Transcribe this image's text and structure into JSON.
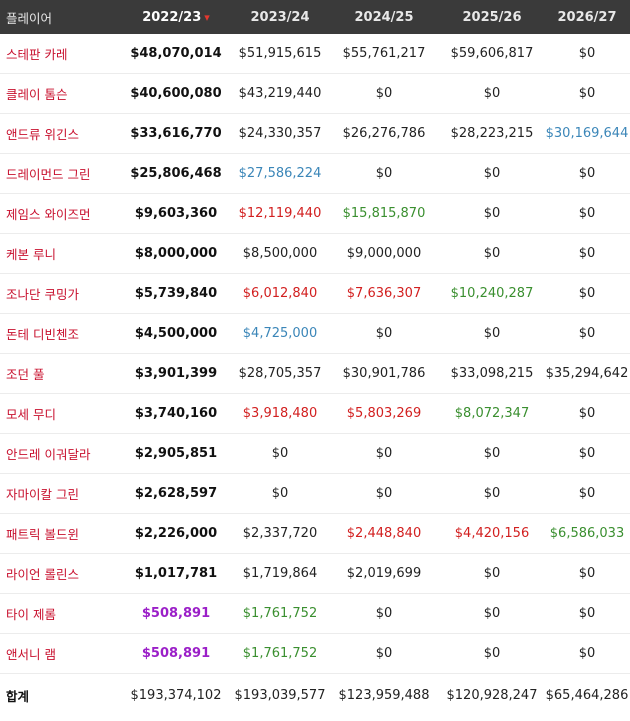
{
  "header": {
    "player_label": "플레이어",
    "years": [
      "2022/23",
      "2023/24",
      "2024/25",
      "2025/26",
      "2026/27"
    ],
    "sort_indicator": "▾"
  },
  "rows": [
    {
      "name": "스테판 카레",
      "c1": "$48,070,014",
      "c2": "$51,915,615",
      "c3": "$55,761,217",
      "c4": "$59,606,817",
      "c5": "$0",
      "k2": "default",
      "k3": "default",
      "k4": "default",
      "k5": "default"
    },
    {
      "name": "클레이 톰슨",
      "c1": "$40,600,080",
      "c2": "$43,219,440",
      "c3": "$0",
      "c4": "$0",
      "c5": "$0",
      "k2": "default",
      "k3": "default",
      "k4": "default",
      "k5": "default"
    },
    {
      "name": "앤드류 위긴스",
      "c1": "$33,616,770",
      "c2": "$24,330,357",
      "c3": "$26,276,786",
      "c4": "$28,223,215",
      "c5": "$30,169,644",
      "k2": "default",
      "k3": "default",
      "k4": "default",
      "k5": "blue"
    },
    {
      "name": "드레이먼드 그린",
      "c1": "$25,806,468",
      "c2": "$27,586,224",
      "c3": "$0",
      "c4": "$0",
      "c5": "$0",
      "k2": "blue",
      "k3": "default",
      "k4": "default",
      "k5": "default"
    },
    {
      "name": "제임스 와이즈먼",
      "c1": "$9,603,360",
      "c2": "$12,119,440",
      "c3": "$15,815,870",
      "c4": "$0",
      "c5": "$0",
      "k2": "red",
      "k3": "green",
      "k4": "default",
      "k5": "default"
    },
    {
      "name": "케본 루니",
      "c1": "$8,000,000",
      "c2": "$8,500,000",
      "c3": "$9,000,000",
      "c4": "$0",
      "c5": "$0",
      "k2": "default",
      "k3": "default",
      "k4": "default",
      "k5": "default"
    },
    {
      "name": "조나단 쿠밍가",
      "c1": "$5,739,840",
      "c2": "$6,012,840",
      "c3": "$7,636,307",
      "c4": "$10,240,287",
      "c5": "$0",
      "k2": "red",
      "k3": "red",
      "k4": "green",
      "k5": "default"
    },
    {
      "name": "돈테 디빈첸조",
      "c1": "$4,500,000",
      "c2": "$4,725,000",
      "c3": "$0",
      "c4": "$0",
      "c5": "$0",
      "k2": "blue",
      "k3": "default",
      "k4": "default",
      "k5": "default"
    },
    {
      "name": "조던 풀",
      "c1": "$3,901,399",
      "c2": "$28,705,357",
      "c3": "$30,901,786",
      "c4": "$33,098,215",
      "c5": "$35,294,642",
      "k2": "default",
      "k3": "default",
      "k4": "default",
      "k5": "default"
    },
    {
      "name": "모세 무디",
      "c1": "$3,740,160",
      "c2": "$3,918,480",
      "c3": "$5,803,269",
      "c4": "$8,072,347",
      "c5": "$0",
      "k2": "red",
      "k3": "red",
      "k4": "green",
      "k5": "default"
    },
    {
      "name": "안드레 이궈달라",
      "c1": "$2,905,851",
      "c2": "$0",
      "c3": "$0",
      "c4": "$0",
      "c5": "$0",
      "k2": "default",
      "k3": "default",
      "k4": "default",
      "k5": "default"
    },
    {
      "name": "자마이칼 그린",
      "c1": "$2,628,597",
      "c2": "$0",
      "c3": "$0",
      "c4": "$0",
      "c5": "$0",
      "k2": "default",
      "k3": "default",
      "k4": "default",
      "k5": "default"
    },
    {
      "name": "패트릭 볼드윈",
      "c1": "$2,226,000",
      "c2": "$2,337,720",
      "c3": "$2,448,840",
      "c4": "$4,420,156",
      "c5": "$6,586,033",
      "k2": "default",
      "k3": "red",
      "k4": "red",
      "k5": "green"
    },
    {
      "name": "라이언 롤린스",
      "c1": "$1,017,781",
      "c2": "$1,719,864",
      "c3": "$2,019,699",
      "c4": "$0",
      "c5": "$0",
      "k2": "default",
      "k3": "default",
      "k4": "default",
      "k5": "default"
    },
    {
      "name": "타이 제롬",
      "c1": "$508,891",
      "c2": "$1,761,752",
      "c3": "$0",
      "c4": "$0",
      "c5": "$0",
      "k1": "purple",
      "k2": "green",
      "k3": "default",
      "k4": "default",
      "k5": "default"
    },
    {
      "name": "앤서니 램",
      "c1": "$508,891",
      "c2": "$1,761,752",
      "c3": "$0",
      "c4": "$0",
      "c5": "$0",
      "k1": "purple",
      "k2": "green",
      "k3": "default",
      "k4": "default",
      "k5": "default"
    }
  ],
  "total": {
    "name": "합계",
    "c1": "$193,374,102",
    "c2": "$193,039,577",
    "c3": "$123,959,488",
    "c4": "$120,928,247",
    "c5": "$65,464,286"
  }
}
